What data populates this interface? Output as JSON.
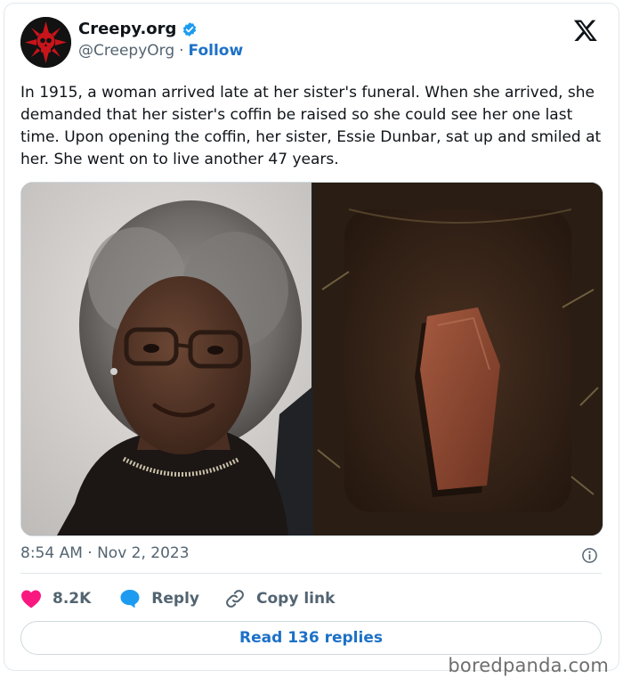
{
  "author": {
    "display_name": "Creepy.org",
    "handle": "@CreepyOrg",
    "separator": "·",
    "follow_label": "Follow"
  },
  "tweet": {
    "text": "In 1915, a woman arrived late at her sister's funeral. When she arrived, she demanded that her sister's coffin be raised so she could see her one last time. Upon opening the coffin, her sister, Essie Dunbar, sat up and smiled at her. She went on to live another 47 years.",
    "timestamp": "8:54 AM · Nov 2, 2023"
  },
  "actions": {
    "likes_count": "8.2K",
    "reply_label": "Reply",
    "copy_link_label": "Copy link",
    "read_replies_label": "Read 136 replies"
  },
  "watermark": "boredpanda.com",
  "colors": {
    "accent": "#1d71c7",
    "like": "#f91880",
    "verified": "#1d9bf0",
    "secondary_text": "#536471"
  },
  "icons": [
    "skull-logo-icon",
    "verified-badge-icon",
    "x-logo-icon",
    "info-icon",
    "heart-icon",
    "reply-bubble-icon",
    "link-icon"
  ]
}
